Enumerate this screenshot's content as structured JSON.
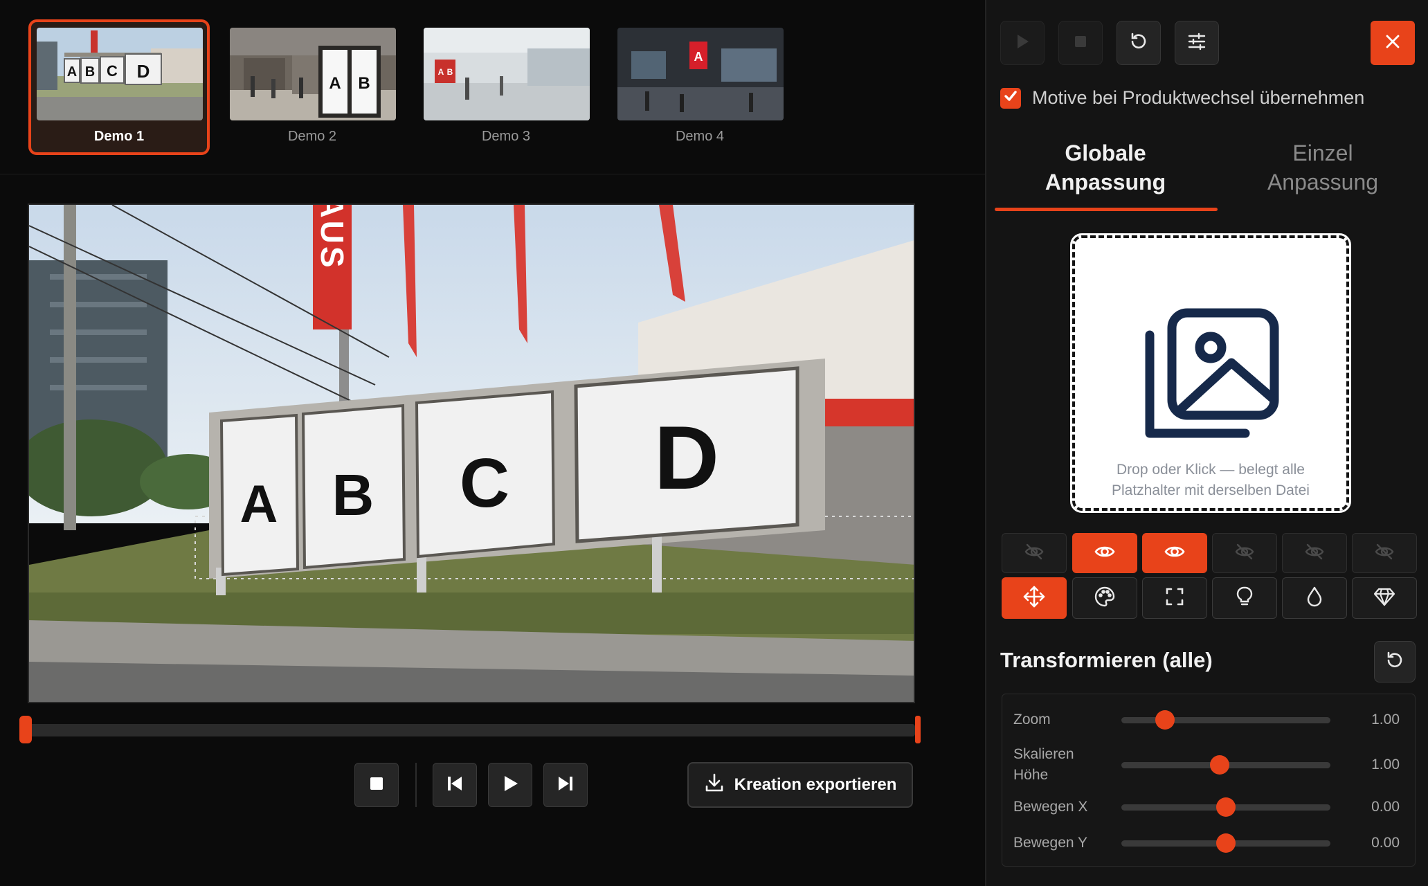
{
  "thumbnails": [
    {
      "label": "Demo 1",
      "active": true
    },
    {
      "label": "Demo 2",
      "active": false
    },
    {
      "label": "Demo 3",
      "active": false
    },
    {
      "label": "Demo 4",
      "active": false
    }
  ],
  "stage": {
    "billboard_letters": [
      "A",
      "B",
      "C",
      "D"
    ],
    "sign_text": "AUS"
  },
  "thumb_letters": {
    "demo1": [
      "A",
      "B",
      "C",
      "D"
    ],
    "demo2": [
      "A",
      "B"
    ],
    "demo3": [
      "A",
      "B"
    ],
    "demo4": [
      "A"
    ]
  },
  "player": {
    "export_label": "Kreation exportieren"
  },
  "panel": {
    "checkbox_label": "Motive bei Produktwechsel übernehmen",
    "checkbox_checked": true,
    "tabs": [
      {
        "line1": "Globale",
        "line2": "Anpassung",
        "active": true
      },
      {
        "line1": "Einzel",
        "line2": "Anpassung",
        "active": false
      }
    ],
    "dropzone": {
      "line1": "Drop oder Klick — belegt alle",
      "line2": "Platzhalter mit derselben Datei"
    },
    "visibility": [
      false,
      true,
      true,
      false,
      false,
      false
    ],
    "tools": [
      "move-icon",
      "palette-icon",
      "crop-icon",
      "lightbulb-icon",
      "drop-icon",
      "diamond-icon"
    ],
    "section_title": "Transformieren (alle)",
    "sliders": [
      {
        "label1": "Zoom",
        "label2": "",
        "value": "1.00",
        "position": 0.21
      },
      {
        "label1": "Skalieren",
        "label2": "Höhe",
        "value": "1.00",
        "position": 0.47
      },
      {
        "label1": "Bewegen X",
        "label2": "",
        "value": "0.00",
        "position": 0.5
      },
      {
        "label1": "Bewegen Y",
        "label2": "",
        "value": "0.00",
        "position": 0.5
      }
    ]
  },
  "colors": {
    "accent": "#e8431a",
    "panel_bg": "#141414",
    "placeholder_icon": "#16294a"
  }
}
